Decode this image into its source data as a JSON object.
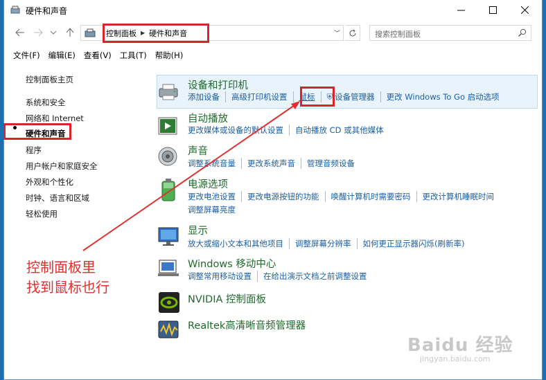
{
  "window": {
    "title": "硬件和声音"
  },
  "address": {
    "crumbs": [
      "控制面板",
      "硬件和声音"
    ],
    "search_placeholder": "搜索控制面板"
  },
  "menu": [
    "文件(F)",
    "编辑(E)",
    "查看(V)",
    "工具(T)",
    "帮助(H)"
  ],
  "sidebar": {
    "items": [
      {
        "label": "控制面板主页"
      },
      {
        "label": "系统和安全"
      },
      {
        "label": "网络和 Internet"
      },
      {
        "label": "硬件和声音",
        "active": true
      },
      {
        "label": "程序"
      },
      {
        "label": "用户帐户和家庭安全"
      },
      {
        "label": "外观和个性化"
      },
      {
        "label": "时钟、语言和区域"
      },
      {
        "label": "轻松使用"
      }
    ]
  },
  "categories": [
    {
      "title": "设备和打印机",
      "icon": "printer-icon",
      "links": [
        "添加设备",
        "高级打印机设置",
        "鼠标",
        "设备管理器",
        "更改 Windows To Go 启动选项"
      ]
    },
    {
      "title": "自动播放",
      "icon": "autoplay-icon",
      "links": [
        "更改媒体或设备的默认设置",
        "自动播放 CD 或其他媒体"
      ]
    },
    {
      "title": "声音",
      "icon": "speaker-icon",
      "links": [
        "调整系统音量",
        "更改系统声音",
        "管理音频设备"
      ]
    },
    {
      "title": "电源选项",
      "icon": "battery-icon",
      "links": [
        "更改电池设置",
        "更改电源按钮的功能",
        "唤醒计算机时需要密码",
        "更改计算机睡眠时间"
      ],
      "links2": [
        "调整屏幕亮度"
      ]
    },
    {
      "title": "显示",
      "icon": "monitor-icon",
      "links": [
        "放大或缩小文本和其他项目",
        "调整屏幕分辨率",
        "如何更正显示器闪烁(刷新率)"
      ]
    },
    {
      "title": "Windows 移动中心",
      "icon": "mobility-center-icon",
      "links": [
        "调整常用移动设置",
        "在给出演示文档之前调整设置"
      ]
    },
    {
      "title": "NVIDIA 控制面板",
      "icon": "nvidia-icon",
      "links": []
    },
    {
      "title": "Realtek高清晰音频管理器",
      "icon": "realtek-icon",
      "links": []
    }
  ],
  "annotation": {
    "line1": "控制面板里",
    "line2": "找到鼠标也行"
  },
  "watermark": {
    "brand": "Baidu 经验",
    "url": "jingyan.baidu.com"
  },
  "colors": {
    "heading": "#1e6b2b",
    "link": "#1b5fa5",
    "annotation": "#e0302f",
    "highlight": "#d7262b"
  }
}
